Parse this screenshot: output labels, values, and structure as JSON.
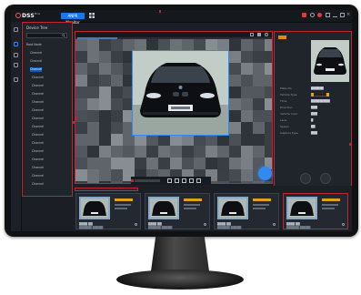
{
  "app": {
    "brand": "DSS",
    "brand_sup": "Pro",
    "module_label": "ANPR Monitor"
  },
  "tree": {
    "title": "Device Tree",
    "search_placeholder": "",
    "nodes": [
      "Root Node",
      "Channel",
      "Channel",
      "Channel",
      "Channel",
      "Channel",
      "Channel",
      "Channel",
      "Channel",
      "Channel",
      "Channel",
      "Channel",
      "Channel",
      "Channel",
      "Channel",
      "Channel",
      "Channel",
      "Channel"
    ],
    "selected_index": 3
  },
  "details": {
    "rows": [
      {
        "label": "Plate No.",
        "value": "██████"
      },
      {
        "label": "Vehicle Type",
        "value": "██████"
      },
      {
        "label": "Time",
        "value": "█████████"
      },
      {
        "label": "Direction",
        "value": "███"
      },
      {
        "label": "Vehicle Color",
        "value": "███"
      },
      {
        "label": "Lane",
        "value": "█"
      },
      {
        "label": "Speed",
        "value": "██"
      },
      {
        "label": "Capture Type",
        "value": "███"
      }
    ]
  },
  "cards": [
    {
      "caption": "████ ██",
      "sub": "██████ █████"
    },
    {
      "caption": "████ ██",
      "sub": "██████ █████"
    },
    {
      "caption": "████ ██",
      "sub": "██████ █████"
    },
    {
      "caption": "████ ██",
      "sub": "██████ █████"
    }
  ],
  "colors": {
    "accent": "#1877f2",
    "highlight": "#c0262f",
    "badge": "#e0a21a"
  }
}
